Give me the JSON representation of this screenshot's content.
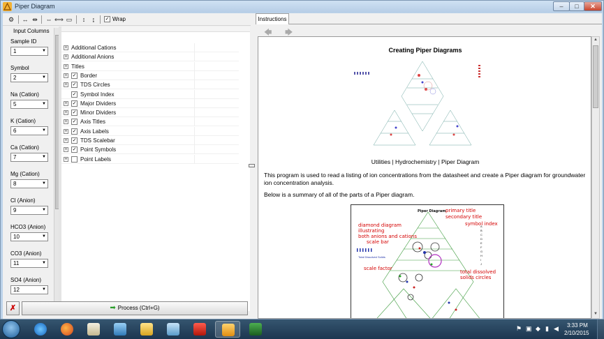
{
  "window": {
    "title": "Piper Diagram",
    "controls": {
      "minimize": "–",
      "maximize": "□",
      "close": "✕"
    }
  },
  "toolbar": {
    "icons": [
      "configure-icon",
      "collapse-columns-icon",
      "expand-columns-icon",
      "shrink-width-icon",
      "fit-width-icon",
      "widen-icon",
      "shrink-height-icon",
      "expand-height-icon"
    ],
    "wrap_label": "Wrap",
    "wrap_checked": true
  },
  "input_columns": {
    "title": "Input Columns",
    "fields": [
      {
        "label": "Sample ID",
        "value": "1"
      },
      {
        "label": "Symbol",
        "value": "2"
      },
      {
        "label": "Na (Cation)",
        "value": "5"
      },
      {
        "label": "K (Cation)",
        "value": "6"
      },
      {
        "label": "Ca (Cation)",
        "value": "7"
      },
      {
        "label": "Mg (Cation)",
        "value": "8"
      },
      {
        "label": "Cl (Anion)",
        "value": "9"
      },
      {
        "label": "HCO3 (Anion)",
        "value": "10"
      },
      {
        "label": "CO3 (Anion)",
        "value": "11"
      },
      {
        "label": "SO4 (Anion)",
        "value": "12"
      }
    ]
  },
  "tree": {
    "items": [
      {
        "label": "Additional Cations",
        "expander": "+",
        "checkbox": false,
        "checked": false
      },
      {
        "label": "Additional Anions",
        "expander": "+",
        "checkbox": false,
        "checked": false
      },
      {
        "label": "Titles",
        "expander": "+",
        "checkbox": false,
        "checked": false
      },
      {
        "label": "Border",
        "expander": "+",
        "checkbox": true,
        "checked": true
      },
      {
        "label": "TDS Circles",
        "expander": "+",
        "checkbox": true,
        "checked": true
      },
      {
        "label": "Symbol Index",
        "expander": "",
        "checkbox": true,
        "checked": true
      },
      {
        "label": "Major Dividers",
        "expander": "+",
        "checkbox": true,
        "checked": true
      },
      {
        "label": "Minor Dividers",
        "expander": "+",
        "checkbox": true,
        "checked": true
      },
      {
        "label": "Axis Titles",
        "expander": "+",
        "checkbox": true,
        "checked": true
      },
      {
        "label": "Axis Labels",
        "expander": "+",
        "checkbox": true,
        "checked": true
      },
      {
        "label": "TDS Scalebar",
        "expander": "+",
        "checkbox": true,
        "checked": true
      },
      {
        "label": "Point Symbols",
        "expander": "+",
        "checkbox": true,
        "checked": true
      },
      {
        "label": "Point Labels",
        "expander": "+",
        "checkbox": true,
        "checked": false
      }
    ]
  },
  "bottom": {
    "cancel_label": "✗",
    "process_label": "Process (Ctrl+G)"
  },
  "instructions": {
    "tab_label": "Instructions",
    "nav_back": "🡄",
    "nav_forward": "🡆",
    "doc_title": "Creating Piper Diagrams",
    "breadcrumb": "Utilities | Hydrochemistry | Piper Diagram",
    "paragraph1": "This program is used to read a listing of ion concentrations from the datasheet and create a Piper diagram for groundwater ion concentration analysis.",
    "paragraph2": "Below is a summary of all of the parts of a Piper diagram.",
    "diagram_annotations": {
      "primary_title": "primary title",
      "secondary_title": "secondary title",
      "diamond": "diamond diagram illustrating\nboth anions and cations",
      "scale_bar": "scale bar",
      "scale_factor": "scale factor",
      "symbol_index": "symbol index",
      "tds": "total dissolved\nsolids circles",
      "inner_title": "Piper Diagram"
    }
  },
  "taskbar": {
    "apps": [
      "internet-explorer",
      "firefox",
      "media-player",
      "remote-desktop",
      "file-explorer",
      "network-people",
      "acrobat",
      "piper-app",
      "excel"
    ],
    "active_app": "piper-app",
    "time": "3:33 PM",
    "date": "2/10/2015"
  },
  "colors": {
    "accent_red": "#d40000",
    "process_green": "#2a9d2a",
    "window_frame": "#bcd3ea"
  }
}
